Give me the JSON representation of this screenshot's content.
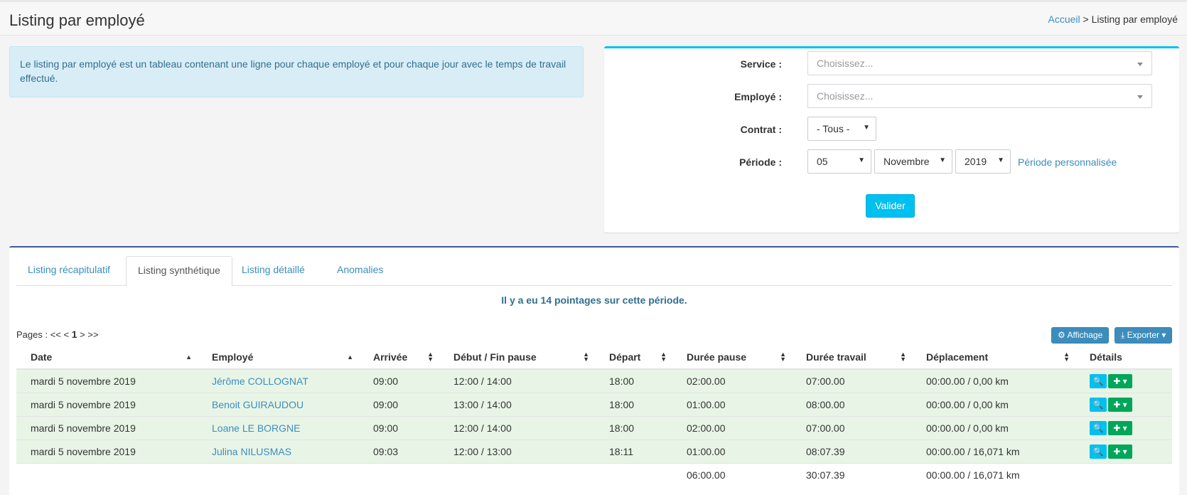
{
  "header": {
    "title": "Listing par employé",
    "breadcrumb_home": "Accueil",
    "breadcrumb_sep": ">",
    "breadcrumb_current": "Listing par employé"
  },
  "info": {
    "text": "Le listing par employé est un tableau contenant une ligne pour chaque employé et pour chaque jour avec le temps de travail effectué."
  },
  "filters": {
    "service_label": "Service :",
    "service_placeholder": "Choisissez...",
    "employe_label": "Employé :",
    "employe_placeholder": "Choisissez...",
    "contrat_label": "Contrat :",
    "contrat_value": "- Tous -",
    "periode_label": "Période :",
    "day_value": "05",
    "month_value": "Novembre",
    "year_value": "2019",
    "periode_link": "Période personnalisée",
    "submit_label": "Valider"
  },
  "tabs": [
    {
      "label": "Listing récapitulatif",
      "active": false
    },
    {
      "label": "Listing synthétique",
      "active": true
    },
    {
      "label": "Listing détaillé",
      "active": false
    },
    {
      "label": "Anomalies",
      "active": false
    }
  ],
  "summary": "Il y a eu 14 pointages sur cette période.",
  "pager": {
    "label": "Pages :",
    "first": "<<",
    "prev": "<",
    "current": "1",
    "next": ">",
    "last": ">>"
  },
  "toolbar": {
    "display_label": "Affichage",
    "export_label": "Exporter"
  },
  "table": {
    "columns": [
      "Date",
      "Employé",
      "Arrivée",
      "Début / Fin pause",
      "Départ",
      "Durée pause",
      "Durée travail",
      "Déplacement",
      "Détails"
    ],
    "rows": [
      {
        "date": "mardi 5 novembre 2019",
        "employe": "Jérôme COLLOGNAT",
        "arrivee": "09:00",
        "pause": "12:00 / 14:00",
        "depart": "18:00",
        "duree_pause": "02:00.00",
        "duree_travail": "07:00.00",
        "deplacement": "00:00.00 / 0,00 km"
      },
      {
        "date": "mardi 5 novembre 2019",
        "employe": "Benoit GUIRAUDOU",
        "arrivee": "09:00",
        "pause": "13:00 / 14:00",
        "depart": "18:00",
        "duree_pause": "01:00.00",
        "duree_travail": "08:00.00",
        "deplacement": "00:00.00 / 0,00 km"
      },
      {
        "date": "mardi 5 novembre 2019",
        "employe": "Loane LE BORGNE",
        "arrivee": "09:00",
        "pause": "12:00 / 14:00",
        "depart": "18:00",
        "duree_pause": "02:00.00",
        "duree_travail": "07:00.00",
        "deplacement": "00:00.00 / 0,00 km"
      },
      {
        "date": "mardi 5 novembre 2019",
        "employe": "Julina NILUSMAS",
        "arrivee": "09:03",
        "pause": "12:00 / 13:00",
        "depart": "18:11",
        "duree_pause": "01:00.00",
        "duree_travail": "08:07.39",
        "deplacement": "00:00.00 / 16,071 km"
      }
    ],
    "totals": {
      "duree_pause": "06:00.00",
      "duree_travail": "30:07.39",
      "deplacement": "00:00.00 / 16,071 km"
    }
  },
  "colors": {
    "accent": "#3c8dbc",
    "info_bg": "#d9edf7",
    "row_bg": "#e8f5e6",
    "cyan": "#00c0ef",
    "green": "#00a65a"
  }
}
